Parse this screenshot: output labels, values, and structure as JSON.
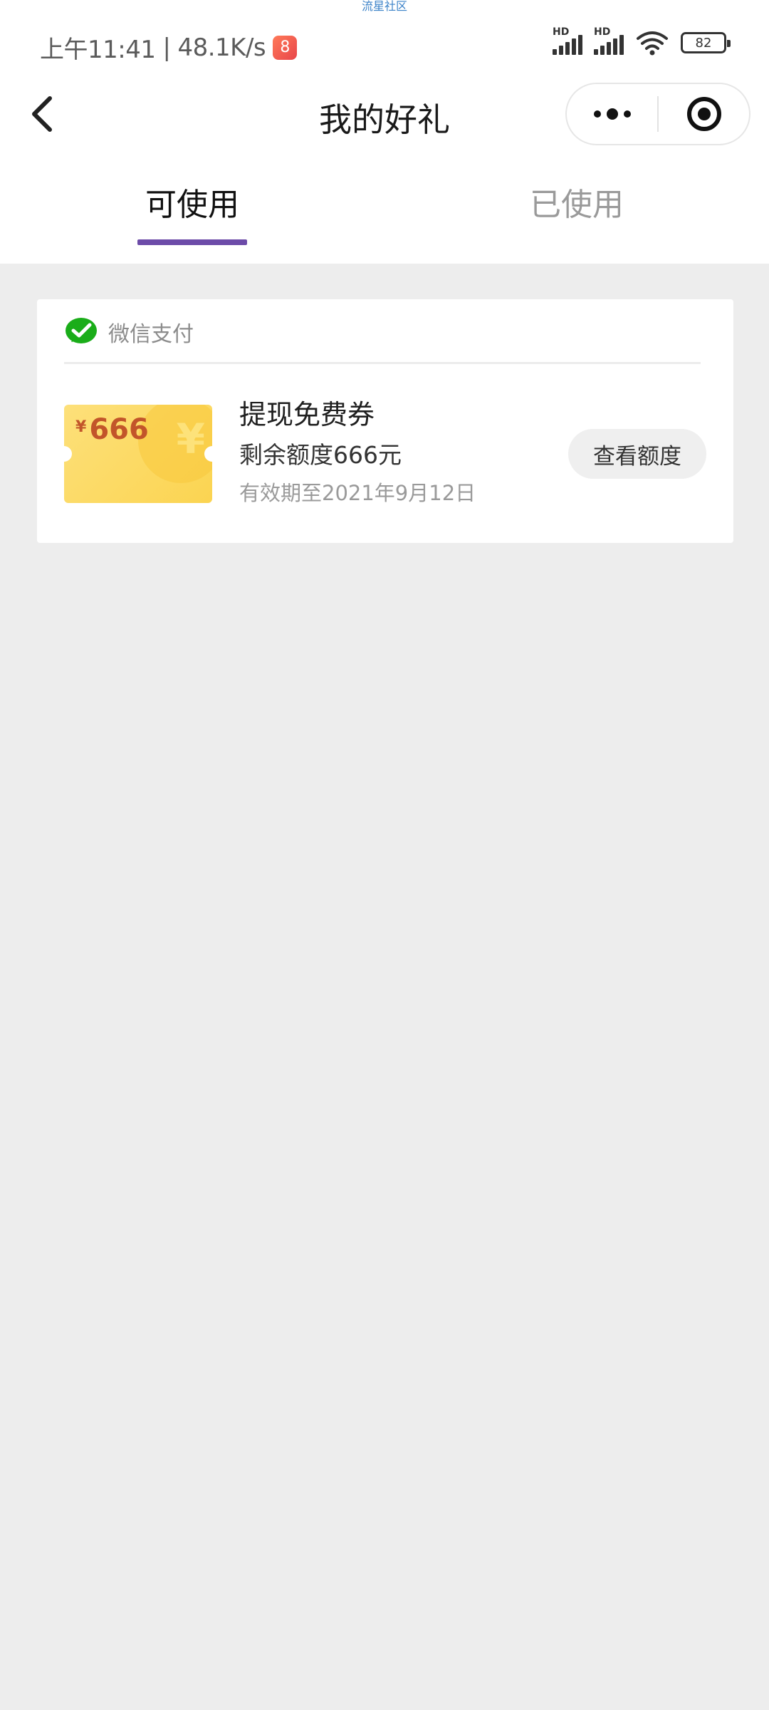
{
  "watermark": "流星社区",
  "status_bar": {
    "time": "上午11:41",
    "separator": "|",
    "net_speed": "48.1K/s",
    "app_badge_glyph": "8",
    "signal_1_label": "HD",
    "signal_2_label": "HD",
    "battery": "82"
  },
  "nav": {
    "title": "我的好礼",
    "back_icon": "chevron-left-icon",
    "more_icon": "more-dots-icon",
    "close_icon": "target-circle-icon"
  },
  "tabs": [
    {
      "label": "可使用",
      "active": true
    },
    {
      "label": "已使用",
      "active": false
    }
  ],
  "card": {
    "source_label": "微信支付",
    "source_icon": "wechat-pay-icon",
    "coupon": {
      "currency": "¥",
      "amount": "666",
      "watermark_symbol": "¥"
    },
    "title": "提现免费券",
    "remaining": "剩余额度666元",
    "expiry": "有效期至2021年9月12日",
    "action_label": "查看额度"
  },
  "colors": {
    "accent": "#6c4ba8",
    "wechat_green": "#1aad19",
    "coupon_yellow": "#fcd95c",
    "coupon_text": "#c2552a",
    "background": "#ededed"
  }
}
